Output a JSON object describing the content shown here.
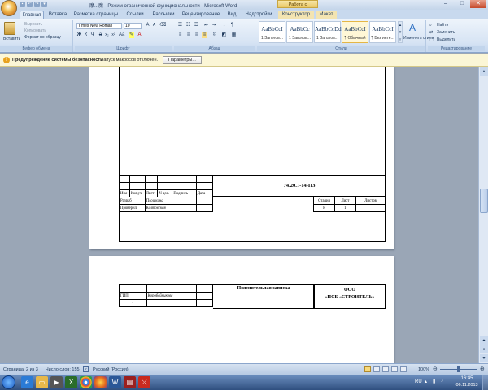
{
  "titlebar": {
    "doc_title": "摩...魔 - Режим ограниченной функциональности - Microsoft Word",
    "context_tab_title": "Работа с таблицами",
    "minimize": "–",
    "maximize": "□",
    "close": "✕"
  },
  "tabs": [
    {
      "label": "Главная"
    },
    {
      "label": "Вставка"
    },
    {
      "label": "Разметка страницы"
    },
    {
      "label": "Ссылки"
    },
    {
      "label": "Рассылки"
    },
    {
      "label": "Рецензирование"
    },
    {
      "label": "Вид"
    },
    {
      "label": "Надстройки"
    },
    {
      "label": "Конструктор"
    },
    {
      "label": "Макет"
    }
  ],
  "ribbon": {
    "clipboard": {
      "paste": "Вставить",
      "cut": "Вырезать",
      "copy": "Копировать",
      "format_painter": "Формат по образцу",
      "caption": "Буфер обмена"
    },
    "font": {
      "name": "Times New Roman",
      "size": "10",
      "caption": "Шрифт"
    },
    "paragraph": {
      "caption": "Абзац"
    },
    "styles": {
      "items": [
        {
          "preview": "AaBbCcI",
          "name": "1 Заголов..."
        },
        {
          "preview": "AaBbCc",
          "name": "1 Заголов..."
        },
        {
          "preview": "AaBbCcDd",
          "name": "1 Заголов..."
        },
        {
          "preview": "AaBbCcI",
          "name": "¶ Обычный"
        },
        {
          "preview": "AaBbCcI",
          "name": "¶ Без инте..."
        }
      ],
      "change_styles": "Изменить стили",
      "caption": "Стили"
    },
    "editing": {
      "find": "Найти",
      "replace": "Заменить",
      "select": "Выделить",
      "caption": "Редактирование"
    }
  },
  "security_bar": {
    "title": "Предупреждение системы безопасности",
    "message": "Запуск макросов отключен.",
    "button": "Параметры..."
  },
  "document": {
    "page1": {
      "code": "74.20.1-14-ПЗ",
      "headers": [
        "Изм",
        "Кол.уч",
        "Лист",
        "N док.",
        "Подпись",
        "Дата"
      ],
      "row_razrab": "Разраб",
      "row_proveril": "Проверил",
      "sign1": "Плошкина",
      "sign2": "Колтовская",
      "stage_label": "Стадия",
      "sheet_label": "Лист",
      "sheets_label": "Листов",
      "stage_value": "Р",
      "sheet_value": "1"
    },
    "page2": {
      "gip": "ГИП",
      "gip_sign": "Коробейникова",
      "note_title": "Пояснительная записка",
      "org_line1": "ООО",
      "org_line2": "«ПСБ «СТРОИТЕЛЬ»",
      "dot": "-"
    }
  },
  "statusbar": {
    "page": "Страница: 2 из 3",
    "words": "Число слов: 155",
    "language": "Русский (Россия)",
    "zoom": "100%"
  },
  "taskbar": {
    "lang": "RU",
    "time": "16:45",
    "date": "06.11.2013"
  },
  "colors": {
    "ribbon_bg": "#dbe6f4",
    "security_bar": "#fbf6d6",
    "taskbar": "#3a5f92",
    "signature_red": "#a4262c"
  }
}
